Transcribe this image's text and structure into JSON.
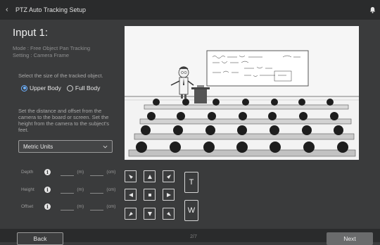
{
  "app": {
    "title": "PTZ Auto Tracking Setup"
  },
  "left": {
    "input_title": "Input 1:",
    "mode_line1": "Mode : Free Object Pan Tracking",
    "mode_line2": "Setting : Camera Frame",
    "size_prompt": "Select the size of the tracked object.",
    "radio_upper": "Upper Body",
    "radio_full": "Full Body",
    "distance_prompt": "Set the distance and offset from the camera to the board or screen. Set the height from the camera to the subject's feet.",
    "units_select": "Metric Units",
    "fields": [
      {
        "label": "Depth",
        "unit_m": "(m)",
        "unit_cm": "(cm)"
      },
      {
        "label": "Height",
        "unit_m": "(m)",
        "unit_cm": "(cm)"
      },
      {
        "label": "Offset",
        "unit_m": "(m)",
        "unit_cm": "(cm)"
      }
    ]
  },
  "zoom": {
    "tele": "T",
    "wide": "W"
  },
  "footer": {
    "back": "Back",
    "page": "2/7",
    "next": "Next"
  },
  "colors": {
    "accent": "#6cb0ff",
    "background": "#3a3b3c",
    "bar": "#2a2b2c"
  },
  "icons": {
    "back": "chevron-left-icon",
    "notification": "bell-icon",
    "info": "info-icon",
    "dropdown": "chevron-down-icon"
  }
}
